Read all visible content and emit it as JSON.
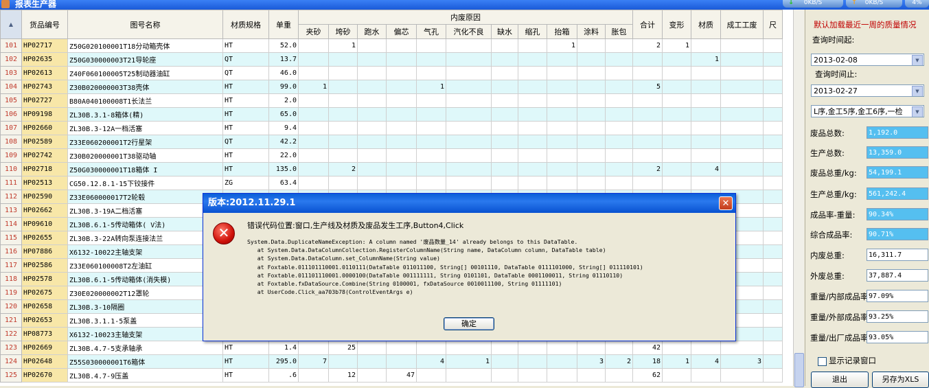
{
  "window": {
    "title": "报表生产器"
  },
  "net_speed": [
    {
      "value": "0KB/S",
      "arrow": "↓",
      "arrow_color": "#2bbf2b"
    },
    {
      "value": "0KB/S",
      "arrow": "↑",
      "arrow_color": "#f0a020"
    },
    {
      "value": "4%",
      "arrow": "",
      "arrow_color": ""
    }
  ],
  "table": {
    "header_group": "内废原因",
    "headers": {
      "corner": "▲",
      "code": "货品编号",
      "name": "图号名称",
      "material": "材质规格",
      "weight": "单重",
      "causes": [
        "夹砂",
        "垮砂",
        "跑水",
        "偏芯",
        "气孔",
        "汽化不良",
        "缺水",
        "缩孔",
        "抬箱",
        "涂料",
        "胀包"
      ],
      "total": "合计",
      "extra": [
        "变形",
        "材质",
        "成工工废",
        "尺"
      ]
    },
    "rows": [
      {
        "n": "101",
        "code": "HP02717",
        "name": "Z50G020100001T18分动箱壳体",
        "mat": "HT",
        "w": "52.0",
        "c": [
          "",
          "1",
          "",
          "",
          "",
          "",
          "",
          "",
          "1",
          "",
          ""
        ],
        "t": "2",
        "e": [
          "1",
          "",
          "",
          ""
        ]
      },
      {
        "n": "102",
        "code": "HP02635",
        "name": "Z50G030000003T21导轮座",
        "mat": "QT",
        "w": "13.7",
        "c": [
          "",
          "",
          "",
          "",
          "",
          "",
          "",
          "",
          "",
          "",
          ""
        ],
        "t": "",
        "e": [
          "",
          "1",
          "",
          ""
        ]
      },
      {
        "n": "103",
        "code": "HP02613",
        "name": "Z40F060100005T25制动器油缸",
        "mat": "QT",
        "w": "46.0",
        "c": [
          "",
          "",
          "",
          "",
          "",
          "",
          "",
          "",
          "",
          "",
          ""
        ],
        "t": "",
        "e": [
          "",
          "",
          "",
          ""
        ]
      },
      {
        "n": "104",
        "code": "HP02743",
        "name": "Z30B020000003T38壳体",
        "mat": "HT",
        "w": "99.0",
        "c": [
          "1",
          "",
          "",
          "",
          "1",
          "",
          "",
          "",
          "",
          "",
          ""
        ],
        "t": "5",
        "e": [
          "",
          "",
          "",
          ""
        ]
      },
      {
        "n": "105",
        "code": "HP02727",
        "name": "B80A040100008T1长法兰",
        "mat": "HT",
        "w": "2.0",
        "c": [
          "",
          "",
          "",
          "",
          "",
          "",
          "",
          "",
          "",
          "",
          ""
        ],
        "t": "",
        "e": [
          "",
          "",
          "",
          ""
        ]
      },
      {
        "n": "106",
        "code": "HP09198",
        "name": "ZL30B.3.1-8箱体(精)",
        "mat": "HT",
        "w": "65.0",
        "c": [
          "",
          "",
          "",
          "",
          "",
          "",
          "",
          "",
          "",
          "",
          ""
        ],
        "t": "",
        "e": [
          "",
          "",
          "",
          ""
        ]
      },
      {
        "n": "107",
        "code": "HP02660",
        "name": "ZL30B.3-12A一档活塞",
        "mat": "HT",
        "w": "9.4",
        "c": [
          "",
          "",
          "",
          "",
          "",
          "",
          "",
          "",
          "",
          "",
          ""
        ],
        "t": "",
        "e": [
          "",
          "",
          "",
          ""
        ]
      },
      {
        "n": "108",
        "code": "HP02589",
        "name": "Z33E060200001T2行星架",
        "mat": "QT",
        "w": "42.2",
        "c": [
          "",
          "",
          "",
          "",
          "",
          "",
          "",
          "",
          "",
          "",
          ""
        ],
        "t": "",
        "e": [
          "",
          "",
          "",
          ""
        ]
      },
      {
        "n": "109",
        "code": "HP02742",
        "name": "Z30B020000001T38驱动轴",
        "mat": "HT",
        "w": "22.0",
        "c": [
          "",
          "",
          "",
          "",
          "",
          "",
          "",
          "",
          "",
          "",
          ""
        ],
        "t": "",
        "e": [
          "",
          "",
          "",
          ""
        ]
      },
      {
        "n": "110",
        "code": "HP02718",
        "name": "Z50G030000001T18箱体 I",
        "mat": "HT",
        "w": "135.0",
        "c": [
          "",
          "2",
          "",
          "",
          "",
          "",
          "",
          "",
          "",
          "",
          ""
        ],
        "t": "2",
        "e": [
          "",
          "4",
          "",
          ""
        ]
      },
      {
        "n": "111",
        "code": "HP02513",
        "name": "CG50.12.8.1-15下铰接件",
        "mat": "ZG",
        "w": "63.4",
        "c": [
          "",
          "",
          "",
          "",
          "",
          "",
          "",
          "",
          "",
          "",
          ""
        ],
        "t": "",
        "e": [
          "",
          "",
          "",
          ""
        ]
      },
      {
        "n": "112",
        "code": "HP02590",
        "name": "Z33E060000017T2轮毂",
        "mat": "",
        "w": "",
        "c": [
          "",
          "",
          "",
          "",
          "",
          "",
          "",
          "",
          "",
          "",
          ""
        ],
        "t": "",
        "e": [
          "",
          "",
          "",
          ""
        ]
      },
      {
        "n": "113",
        "code": "HP02662",
        "name": "ZL30B.3-19A二档活塞",
        "mat": "",
        "w": "",
        "c": [
          "",
          "",
          "",
          "",
          "",
          "",
          "",
          "",
          "",
          "",
          ""
        ],
        "t": "",
        "e": [
          "",
          "",
          "",
          ""
        ]
      },
      {
        "n": "114",
        "code": "HP09610",
        "name": "ZL30B.6.1-5传动箱体( V法)",
        "mat": "",
        "w": "",
        "c": [
          "",
          "",
          "",
          "",
          "",
          "",
          "",
          "",
          "",
          "",
          ""
        ],
        "t": "",
        "e": [
          "",
          "",
          "",
          ""
        ]
      },
      {
        "n": "115",
        "code": "HP02655",
        "name": "ZL30B.3-22A转向泵连接法兰",
        "mat": "",
        "w": "",
        "c": [
          "",
          "",
          "",
          "",
          "",
          "",
          "",
          "",
          "",
          "",
          ""
        ],
        "t": "",
        "e": [
          "",
          "",
          "",
          ""
        ]
      },
      {
        "n": "116",
        "code": "HP07886",
        "name": "X6132-10022主轴支架",
        "mat": "",
        "w": "",
        "c": [
          "",
          "",
          "",
          "",
          "",
          "",
          "",
          "",
          "",
          "",
          ""
        ],
        "t": "",
        "e": [
          "",
          "",
          "",
          ""
        ]
      },
      {
        "n": "117",
        "code": "HP02586",
        "name": "Z33E060100008T2左油缸",
        "mat": "",
        "w": "",
        "c": [
          "",
          "",
          "",
          "",
          "",
          "",
          "",
          "",
          "",
          "",
          ""
        ],
        "t": "",
        "e": [
          "",
          "",
          "",
          ""
        ]
      },
      {
        "n": "118",
        "code": "HP02578",
        "name": "ZL30B.6.1-5传动箱体(消失模)",
        "mat": "",
        "w": "",
        "c": [
          "",
          "",
          "",
          "",
          "",
          "",
          "",
          "",
          "",
          "",
          ""
        ],
        "t": "",
        "e": [
          "",
          "",
          "",
          ""
        ]
      },
      {
        "n": "119",
        "code": "HP02675",
        "name": "Z30E020000002T12罩轮",
        "mat": "",
        "w": "",
        "c": [
          "",
          "",
          "",
          "",
          "",
          "",
          "",
          "",
          "",
          "",
          ""
        ],
        "t": "",
        "e": [
          "",
          "",
          "",
          ""
        ]
      },
      {
        "n": "120",
        "code": "HP02658",
        "name": "ZL30B.3-10隔圈",
        "mat": "",
        "w": "",
        "c": [
          "",
          "",
          "",
          "",
          "",
          "",
          "",
          "",
          "",
          "",
          ""
        ],
        "t": "",
        "e": [
          "",
          "",
          "",
          ""
        ]
      },
      {
        "n": "121",
        "code": "HP02653",
        "name": "ZL30B.3.1.1-5泵盖",
        "mat": "",
        "w": "",
        "c": [
          "",
          "",
          "",
          "",
          "",
          "",
          "",
          "",
          "",
          "",
          ""
        ],
        "t": "",
        "e": [
          "",
          "",
          "",
          ""
        ]
      },
      {
        "n": "122",
        "code": "HP08773",
        "name": "X6132-10023主轴支架",
        "mat": "",
        "w": "",
        "c": [
          "",
          "",
          "",
          "",
          "",
          "",
          "",
          "",
          "",
          "",
          ""
        ],
        "t": "",
        "e": [
          "",
          "",
          "",
          ""
        ]
      },
      {
        "n": "123",
        "code": "HP02669",
        "name": "ZL30B.4.7-5支承轴承",
        "mat": "HT",
        "w": "1.4",
        "c": [
          "",
          "25",
          "",
          "",
          "",
          "",
          "",
          "",
          "",
          "",
          ""
        ],
        "t": "42",
        "e": [
          "",
          "",
          "",
          ""
        ]
      },
      {
        "n": "124",
        "code": "HP02648",
        "name": "Z55S030000001T6箱体",
        "mat": "HT",
        "w": "295.0",
        "c": [
          "7",
          "",
          "",
          "",
          "4",
          "1",
          "",
          "",
          "",
          "3",
          "2"
        ],
        "t": "18",
        "e": [
          "1",
          "4",
          "3",
          ""
        ]
      },
      {
        "n": "125",
        "code": "HP02670",
        "name": "ZL30B.4.7-9压盖",
        "mat": "HT",
        "w": ".6",
        "c": [
          "",
          "12",
          "",
          "47",
          "",
          "",
          "",
          "",
          "",
          "",
          ""
        ],
        "t": "62",
        "e": [
          "",
          "",
          "",
          ""
        ]
      }
    ]
  },
  "panel": {
    "header": "默认加载最近一周的质量情况",
    "from_label": "查询时间起:",
    "from_value": "2013-02-08",
    "to_label": "查询时间止:",
    "to_value": "2013-02-27",
    "process_value": "L序,金工5序,金工6序,一检",
    "stats": [
      {
        "label": "废品总数:",
        "value": "1,192.0",
        "hl": true
      },
      {
        "label": "生产总数:",
        "value": "13,359.0",
        "hl": true
      },
      {
        "label": "废品总重/kg:",
        "value": "54,199.1",
        "hl": true
      },
      {
        "label": "生产总重/kg:",
        "value": "561,242.4",
        "hl": true
      },
      {
        "label": "成品率-重量:",
        "value": "90.34%",
        "hl": true
      },
      {
        "label": "综合成品率:",
        "value": "90.71%",
        "hl": true
      },
      {
        "label": "内废总重:",
        "value": "16,311.7",
        "hl": false
      },
      {
        "label": "外废总重:",
        "value": "37,887.4",
        "hl": false
      },
      {
        "label": "重量/内部成品率:",
        "value": "97.09%",
        "hl": false
      },
      {
        "label": "重量/外部成品率:",
        "value": "93.25%",
        "hl": false
      },
      {
        "label": "重量/出厂成品率:",
        "value": "93.05%",
        "hl": false
      }
    ],
    "show_log_label": "显示记录窗口",
    "exit_label": "退出",
    "save_label": "另存为XLS"
  },
  "dialog": {
    "title": "版本:2012.11.29.1",
    "close": "✕",
    "icon": "✕",
    "message": "错误代码位置:窗口,生产线及材质及废品发生工序,Button4,Click",
    "trace": [
      "System.Data.DuplicateNameException: A column named '废品数量_14' already belongs to this DataTable.",
      "   at System.Data.DataColumnCollection.RegisterColumnName(String name, DataColumn column, DataTable table)",
      "   at System.Data.DataColumn.set_ColumnName(String value)",
      "   at Foxtable.011101110001.0110111(DataTable 011011100, String[] 00101110, DataTable 0111101000, String[] 011110101)",
      "   at Foxtable.011101110001.0000100(DataTable 001111111, String 0101101, DataTable 0001100011, String 01110110)",
      "   at Foxtable.fxDataSource.Combine(String 0100001, fxDataSource 0010011100, String 01111101)",
      "   at UserCode.Click_aa703b78(ControlEventArgs e)"
    ],
    "ok_label": "确定"
  },
  "colors": {
    "accent": "#0a5fd8",
    "row_alt": "#dff8fa",
    "code_col": "#f8e7a8",
    "row_num": "#c0392b",
    "header_red": "#c00000",
    "stat_highlight": "#55bff0"
  }
}
